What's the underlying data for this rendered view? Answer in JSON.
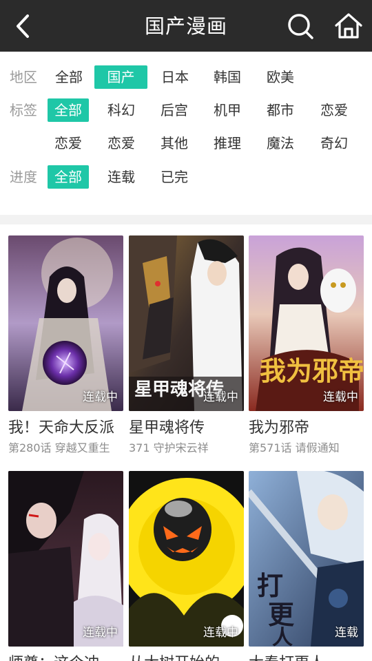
{
  "header": {
    "title": "国产漫画",
    "back_icon": "chevron-left-icon",
    "search_icon": "search-icon",
    "home_icon": "home-icon",
    "background": "#2b2b2b"
  },
  "filters": {
    "accent": "#1fc7a7",
    "region": {
      "label": "地区",
      "options": [
        "全部",
        "国产",
        "日本",
        "韩国",
        "欧美"
      ],
      "selected": "国产"
    },
    "tags": {
      "label": "标签",
      "options": [
        "全部",
        "科幻",
        "后宫",
        "机甲",
        "都市",
        "恋爱",
        "恋爱",
        "恋爱",
        "其他",
        "推理",
        "魔法",
        "奇幻"
      ],
      "selected": "全部"
    },
    "progress": {
      "label": "进度",
      "options": [
        "全部",
        "连载",
        "已完"
      ],
      "selected": "全部"
    }
  },
  "comics": [
    {
      "title": "我！天命大反派",
      "subtitle": "第280话 穿越又重生",
      "status": "连载中"
    },
    {
      "title": "星甲魂将传",
      "subtitle": "371 守护宋云祥",
      "status": "连载中"
    },
    {
      "title": "我为邪帝",
      "subtitle": "第571话 请假通知",
      "status": "连载中"
    },
    {
      "title": "师尊：这个冲逆徒",
      "subtitle": "",
      "status": "连载中"
    },
    {
      "title": "从大树开始的进化",
      "subtitle": "",
      "status": "连载中"
    },
    {
      "title": "大奉打更人",
      "subtitle": "",
      "status": "连载"
    }
  ]
}
